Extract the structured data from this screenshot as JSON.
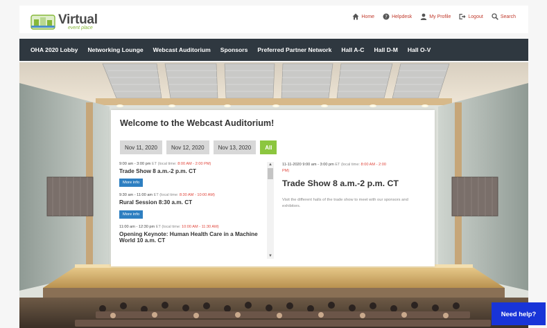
{
  "logo": {
    "text": "Virtual",
    "sub": "event place"
  },
  "topnav": [
    {
      "label": "Home",
      "icon": "home-icon"
    },
    {
      "label": "Helpdesk",
      "icon": "help-icon"
    },
    {
      "label": "My Profile",
      "icon": "user-icon"
    },
    {
      "label": "Logout",
      "icon": "logout-icon"
    },
    {
      "label": "Search",
      "icon": "search-icon"
    }
  ],
  "mainnav": [
    "OHA 2020 Lobby",
    "Networking Lounge",
    "Webcast Auditorium",
    "Sponsors",
    "Preferred Partner Network",
    "Hall A-C",
    "Hall D-M",
    "Hall O-V"
  ],
  "panel": {
    "title": "Welcome to the Webcast Auditorium!",
    "tabs": [
      "Nov 11, 2020",
      "Nov 12, 2020",
      "Nov 13, 2020",
      "All"
    ],
    "sessions": [
      {
        "time": "9:00 am - 3:00 pm",
        "tz": "ET",
        "local_label": "(local time:",
        "local": "8:00 AM - 2:00 PM)",
        "title": "Trade Show 8 a.m.-2 p.m. CT",
        "button": "More info"
      },
      {
        "time": "9:30 am - 11:00 am",
        "tz": "ET",
        "local_label": "(local time:",
        "local": "8:30 AM - 10:00 AM)",
        "title": "Rural Session 8:30 a.m. CT",
        "button": "More info"
      },
      {
        "time": "11:00 am - 12:30 pm",
        "tz": "ET",
        "local_label": "(local time:",
        "local": "10:00 AM - 11:30 AM)",
        "title": "Opening Keynote: Human Health Care in a Machine World 10 a.m. CT",
        "button": ""
      }
    ],
    "detail": {
      "date": "11-11-2020",
      "time": "9:00 am - 3:00 pm",
      "tz": "ET",
      "local_label": "(local time:",
      "local_a": "8:00 AM - 2:00",
      "local_b": "PM)",
      "title": "Trade Show 8 a.m.-2 p.m. CT",
      "description": "Visit the different halls of the trade show to meet with our sponsors and exhibitors."
    }
  },
  "help_label": "Need help?",
  "colors": {
    "nav_bg": "#2f3840",
    "accent_green": "#8cc63f",
    "link_red": "#e0473d",
    "button_blue": "#2e7fc1",
    "help_blue": "#1834d8"
  }
}
